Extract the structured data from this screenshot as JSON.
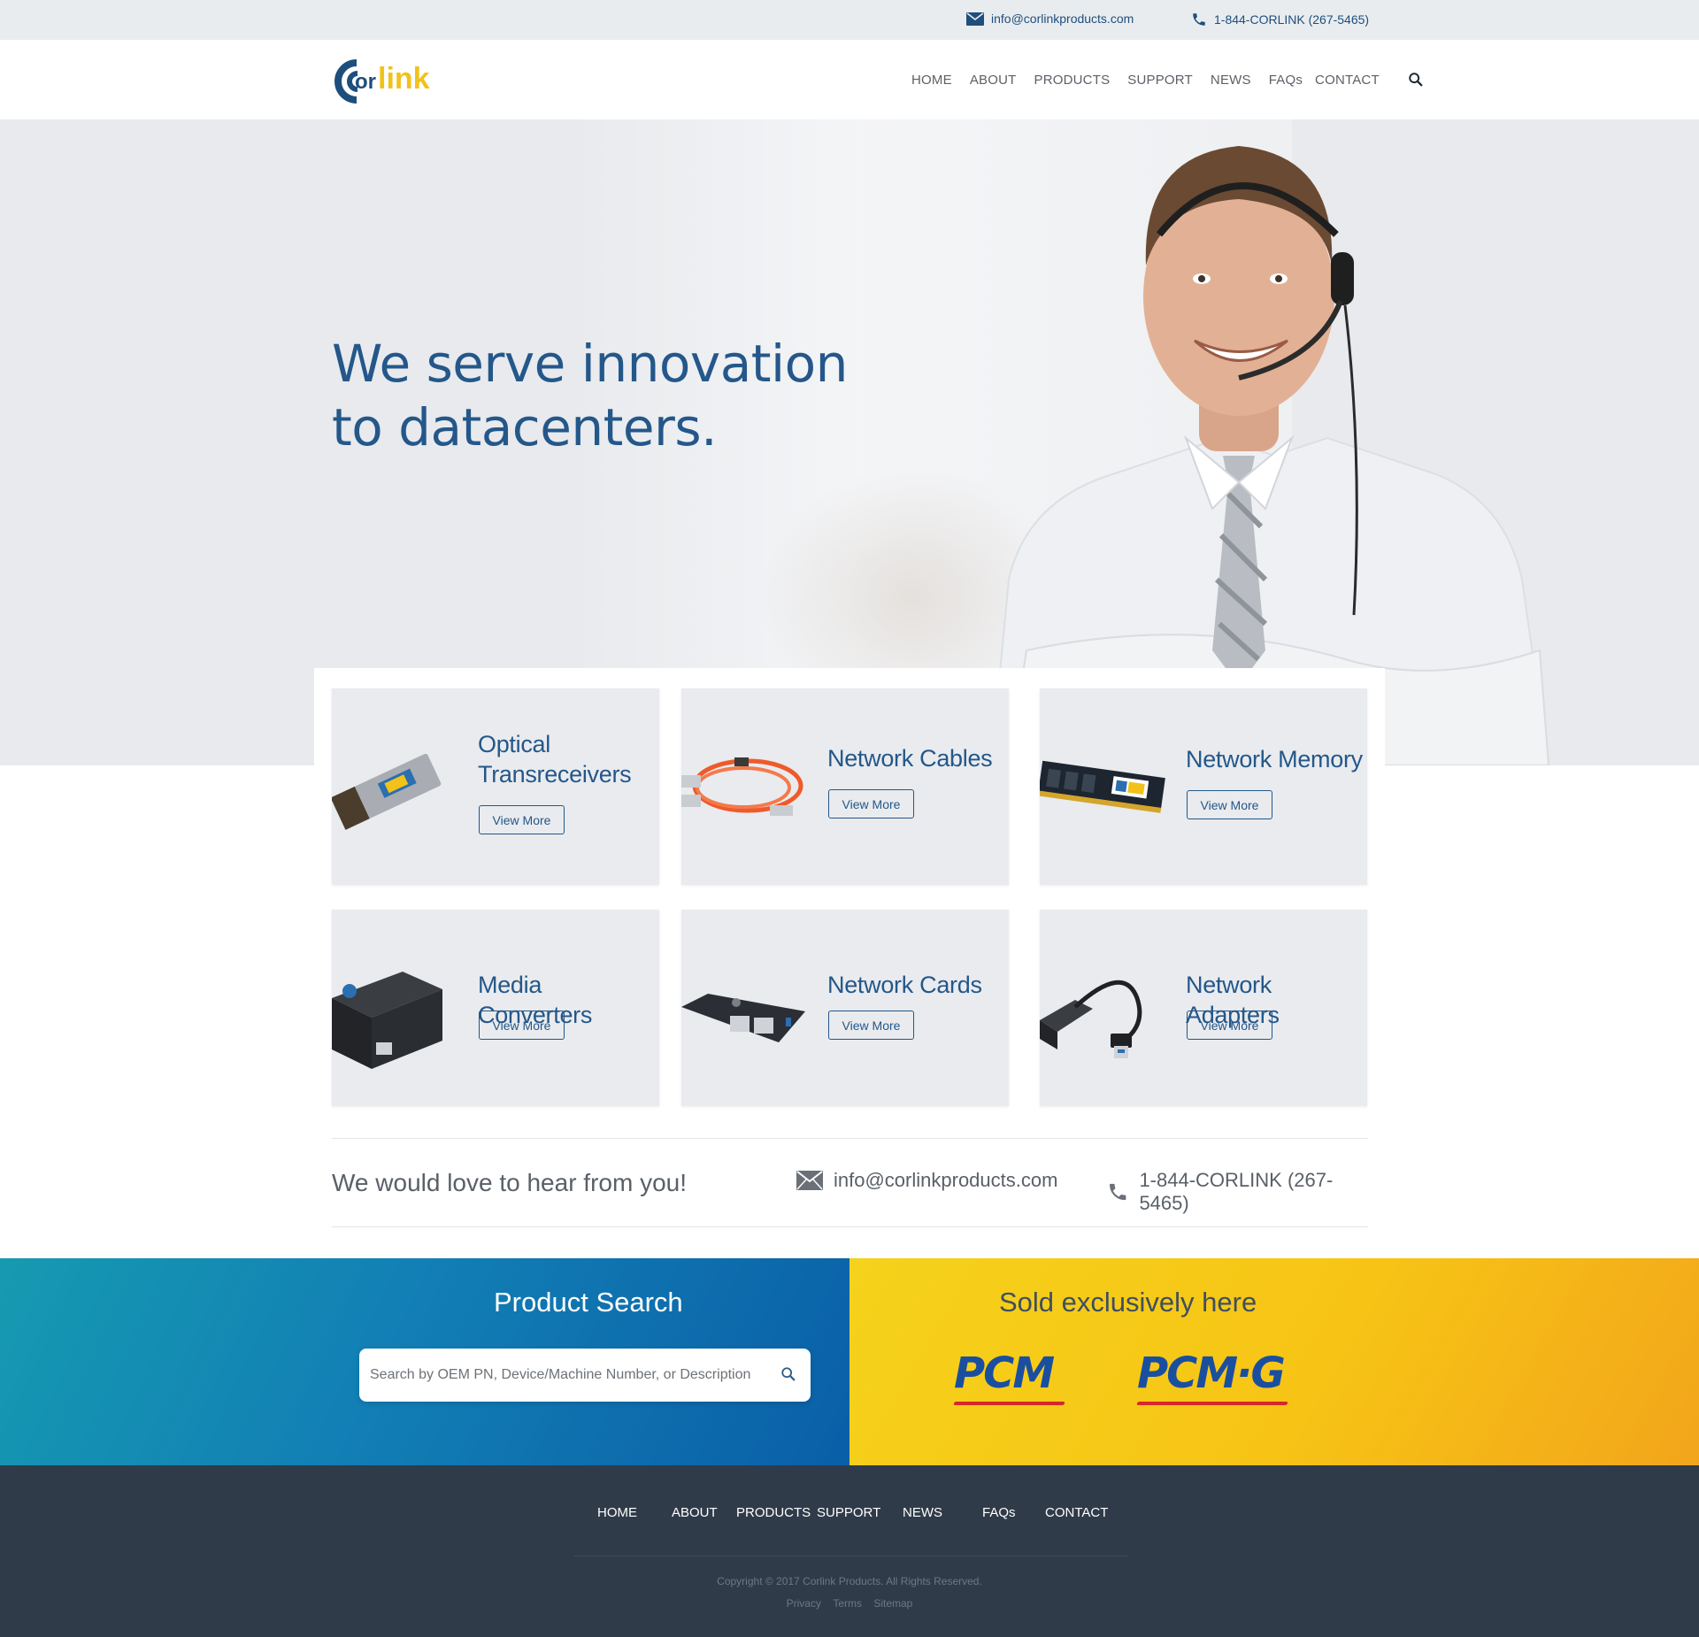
{
  "topbar": {
    "email": "info@corlinkproducts.com",
    "phone": "1-844-CORLINK (267-5465)"
  },
  "header": {
    "logo_text_c": "C",
    "logo_text_or": "or",
    "logo_text_link": "link",
    "nav": [
      "HOME",
      "ABOUT",
      "PRODUCTS",
      "SUPPORT",
      "NEWS",
      "FAQs",
      "CONTACT"
    ]
  },
  "hero": {
    "headline_line1": "We serve innovation",
    "headline_line2": "to datacenters."
  },
  "products": [
    {
      "title_line1": "Optical",
      "title_line2": "Transreceivers",
      "button": "View More"
    },
    {
      "title_line1": "Network Cables",
      "title_line2": "",
      "button": "View More"
    },
    {
      "title_line1": "Network Memory",
      "title_line2": "",
      "button": "View More"
    },
    {
      "title_line1": "Media Converters",
      "title_line2": "",
      "button": "View More"
    },
    {
      "title_line1": "Network Cards",
      "title_line2": "",
      "button": "View More"
    },
    {
      "title_line1": "Network Adapters",
      "title_line2": "",
      "button": "View More"
    }
  ],
  "contact_strip": {
    "message": "We would love to hear from you!",
    "email": "info@corlinkproducts.com",
    "phone": "1-844-CORLINK (267-5465)"
  },
  "search_section": {
    "title": "Product Search",
    "placeholder": "Search by OEM PN, Device/Machine Number, or Description"
  },
  "sold_section": {
    "title": "Sold exclusively here",
    "retailer1": "PCM",
    "retailer2": "PCM·G"
  },
  "footer": {
    "nav": [
      "HOME",
      "ABOUT",
      "PRODUCTS",
      "SUPPORT",
      "NEWS",
      "FAQs",
      "CONTACT"
    ],
    "copyright": "Copyright © 2017 Corlink Products. All Rights Reserved.",
    "links": [
      "Privacy",
      "Terms",
      "Sitemap"
    ]
  },
  "colors": {
    "brand_blue": "#24578a",
    "brand_yellow": "#f5c518",
    "footer_bg": "#2f3b49"
  }
}
